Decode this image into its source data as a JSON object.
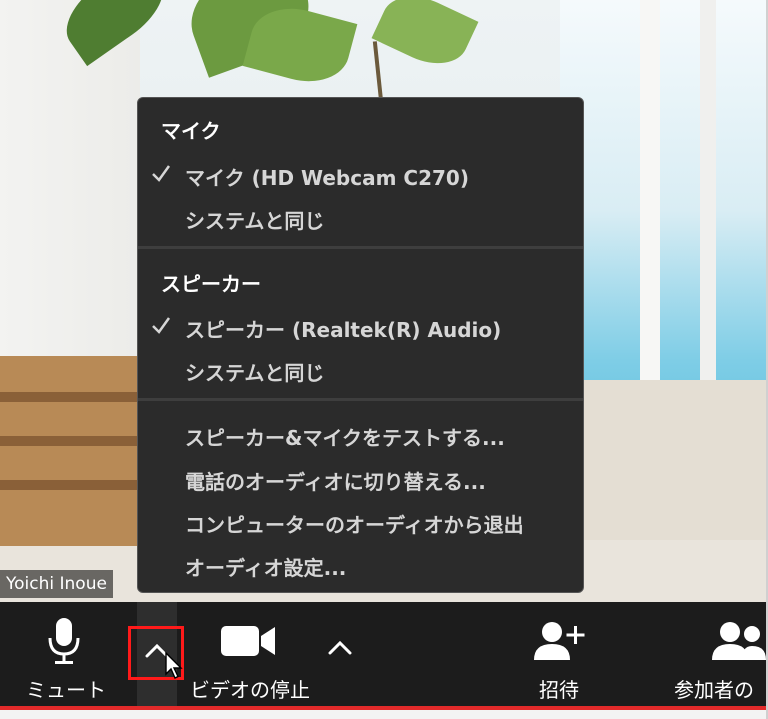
{
  "video": {
    "participant_name": "Yoichi Inoue"
  },
  "audio_menu": {
    "mic_heading": "マイク",
    "mic_devices": [
      {
        "label": "マイク (HD Webcam C270)",
        "selected": true
      },
      {
        "label": "システムと同じ",
        "selected": false
      }
    ],
    "speaker_heading": "スピーカー",
    "speaker_devices": [
      {
        "label": "スピーカー (Realtek(R) Audio)",
        "selected": true
      },
      {
        "label": "システムと同じ",
        "selected": false
      }
    ],
    "actions": [
      "スピーカー&マイクをテストする...",
      "電話のオーディオに切り替える...",
      "コンピューターのオーディオから退出",
      "オーディオ設定..."
    ]
  },
  "toolbar": {
    "mute_label": "ミュート",
    "video_label": "ビデオの停止",
    "invite_label": "招待",
    "participants_label": "参加者の"
  },
  "colors": {
    "toolbar_bg": "#1c1c1c",
    "menu_bg": "#2b2b2b",
    "highlight_box": "#ff1a1a",
    "bottom_strip": "#e22a2a"
  }
}
